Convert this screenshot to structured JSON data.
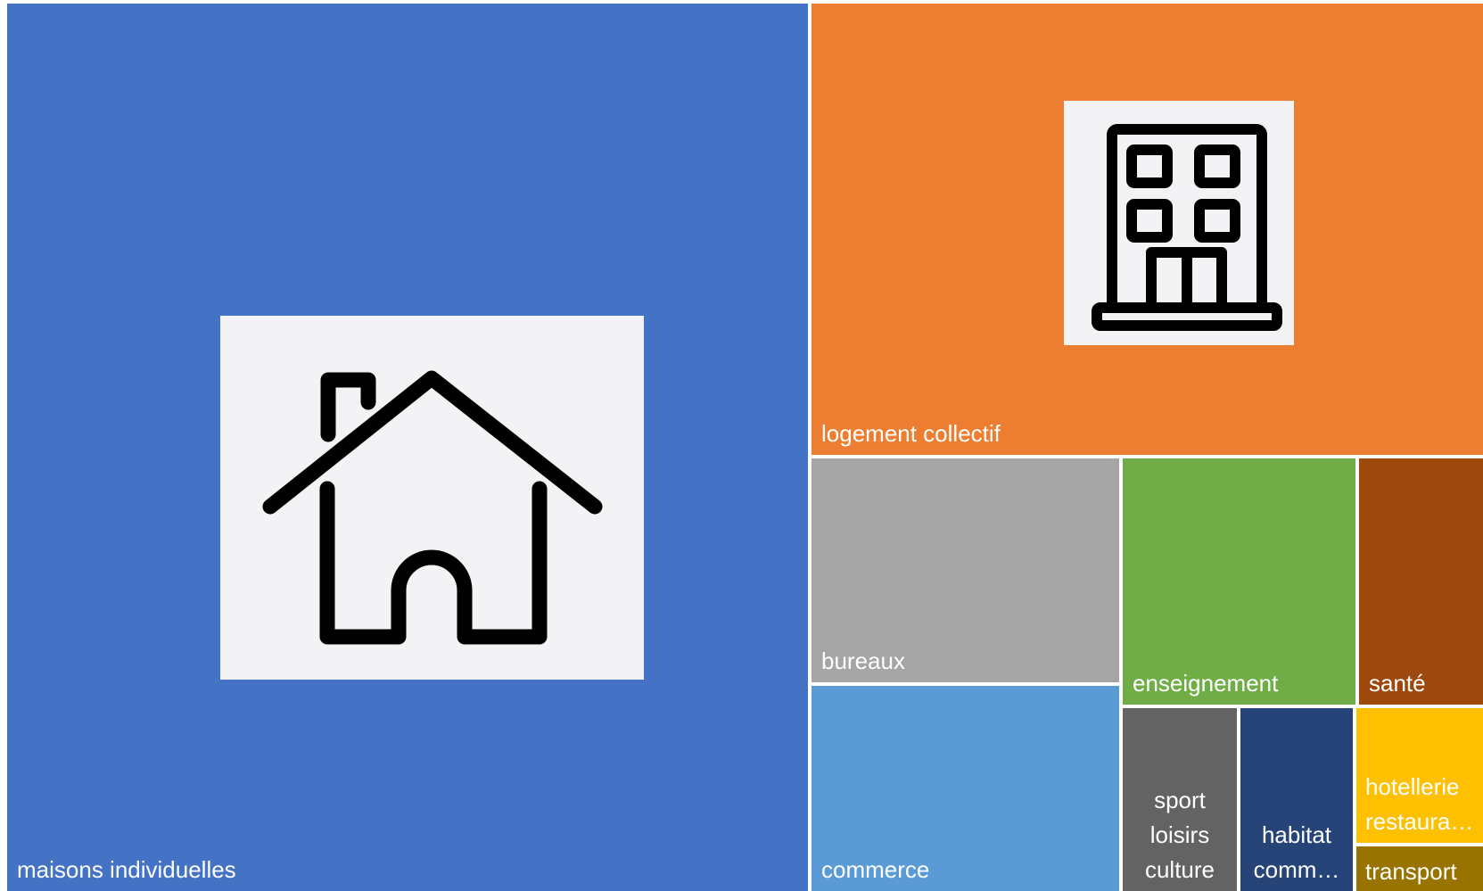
{
  "chart_data": {
    "type": "treemap",
    "title": "",
    "items": [
      {
        "label": "maisons individuelles",
        "value": 54.6,
        "color": "#4472c4",
        "icon": "house-icon"
      },
      {
        "label": "logement collectif",
        "value": 21.6,
        "color": "#ed7d31",
        "icon": "apartment-building-icon"
      },
      {
        "label": "bureaux",
        "value": 4.9,
        "color": "#a5a5a5"
      },
      {
        "label": "commerce",
        "value": 4.7,
        "color": "#5b9bd5"
      },
      {
        "label": "enseignement",
        "value": 3.9,
        "color": "#70ad47"
      },
      {
        "label": "santé",
        "value": 2.2,
        "color": "#9e480e"
      },
      {
        "label": "sport\nloisirs\nculture",
        "value": 1.9,
        "color": "#636363"
      },
      {
        "label": "habitat\ncomm…",
        "value": 1.8,
        "color": "#264478"
      },
      {
        "label": "hotellerie\nrestaura…",
        "value": 1.0,
        "color": "#ffc000"
      },
      {
        "label": "transport",
        "value": 0.4,
        "color": "#997300"
      }
    ]
  }
}
